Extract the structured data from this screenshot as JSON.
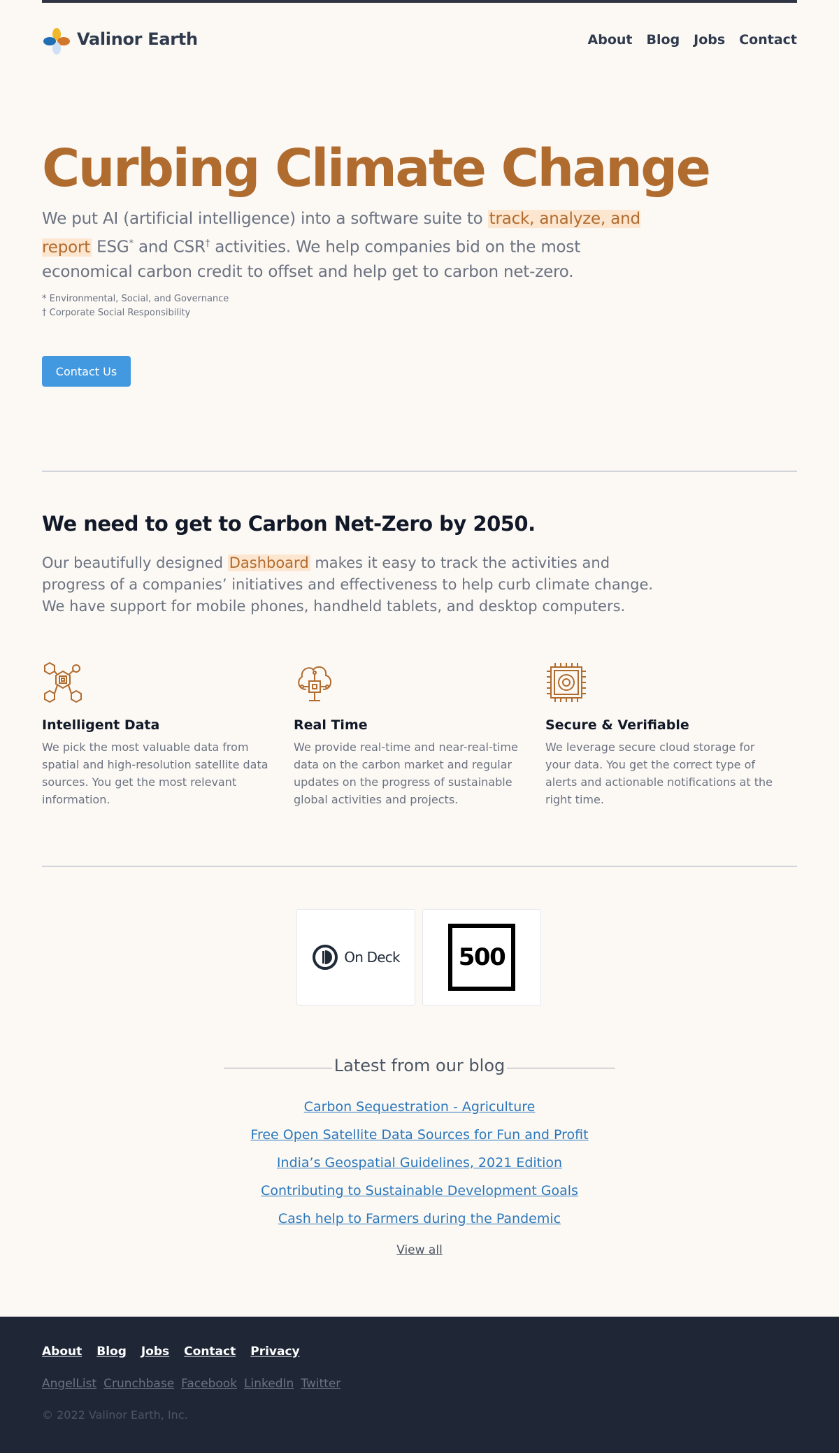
{
  "header": {
    "brand": "Valinor Earth",
    "nav": [
      "About",
      "Blog",
      "Jobs",
      "Contact"
    ]
  },
  "hero": {
    "title": "Curbing Climate Change",
    "text_before": "We put AI (artificial intelligence) into a software suite to ",
    "highlight": "track, analyze, and report",
    "text_esg": " ESG",
    "sup_1": "*",
    "text_and": " and CSR",
    "sup_2": "†",
    "text_after": " activities. We help companies bid on the most economical carbon credit to offset and help get to carbon net-zero.",
    "note_1": "* Environmental, Social, and Governance",
    "note_2": "† Corporate Social Responsibility",
    "cta": "Contact Us"
  },
  "section": {
    "title": "We need to get to Carbon Net-Zero by 2050.",
    "text_before": "Our beautifully designed ",
    "highlight": "Dashboard",
    "text_after": " makes it easy to track the activities and progress of a companies’ initiatives and effectiveness to help curb climate change. We have support for mobile phones, handheld tablets, and desktop computers."
  },
  "features": [
    {
      "icon": "hexagon-chip-icon",
      "title": "Intelligent Data",
      "text": "We pick the most valuable data from spatial and high-resolution satellite data sources. You get the most relevant information."
    },
    {
      "icon": "circuit-tree-icon",
      "title": "Real Time",
      "text": "We provide real-time and near-real-time data on the carbon market and regular updates on the progress of sustainable global activities and projects."
    },
    {
      "icon": "secure-chip-icon",
      "title": "Secure & Verifiable",
      "text": "We leverage secure cloud storage for your data. You get the correct type of alerts and actionable notifications at the right time."
    }
  ],
  "partners": {
    "ondeck": "On Deck",
    "five_hundred": "500"
  },
  "blog": {
    "heading": "Latest from our blog",
    "posts": [
      "Carbon Sequestration - Agriculture",
      "Free Open Satellite Data Sources for Fun and Profit",
      "India’s Geospatial Guidelines, 2021 Edition",
      "Contributing to Sustainable Development Goals",
      "Cash help to Farmers during the Pandemic"
    ],
    "view_all": "View all"
  },
  "footer": {
    "nav": [
      "About",
      "Blog",
      "Jobs",
      "Contact",
      "Privacy"
    ],
    "social": [
      "AngelList",
      "Crunchbase",
      "Facebook",
      "LinkedIn",
      "Twitter"
    ],
    "copyright": "© 2022 Valinor Earth, Inc."
  },
  "colors": {
    "accent": "#b06b2f",
    "highlight_bg": "#fde6cf",
    "button": "#4399e0",
    "link": "#2b77ba",
    "footer_bg": "#1f2737",
    "page_bg": "#fcf9f5"
  }
}
